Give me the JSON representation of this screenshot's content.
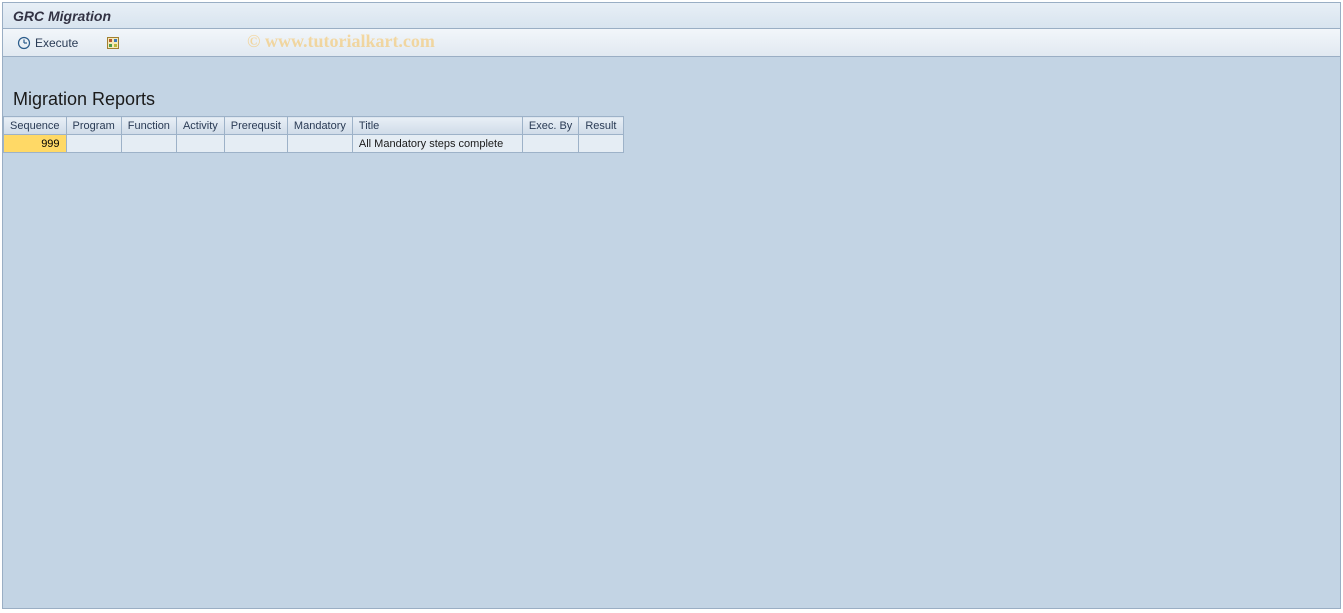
{
  "header": {
    "title": "GRC Migration"
  },
  "toolbar": {
    "execute_label": "Execute"
  },
  "watermark": "© www.tutorialkart.com",
  "section": {
    "title": "Migration Reports"
  },
  "grid": {
    "columns": {
      "sequence": "Sequence",
      "program": "Program",
      "function": "Function",
      "activity": "Activity",
      "prerequisit": "Prerequsit",
      "mandatory": "Mandatory",
      "title": "Title",
      "exec_by": "Exec. By",
      "result": "Result"
    },
    "rows": [
      {
        "sequence": "999",
        "program": "",
        "function": "",
        "activity": "",
        "prerequisit": "",
        "mandatory": "",
        "title": "All Mandatory steps complete",
        "exec_by": "",
        "result": ""
      }
    ]
  }
}
